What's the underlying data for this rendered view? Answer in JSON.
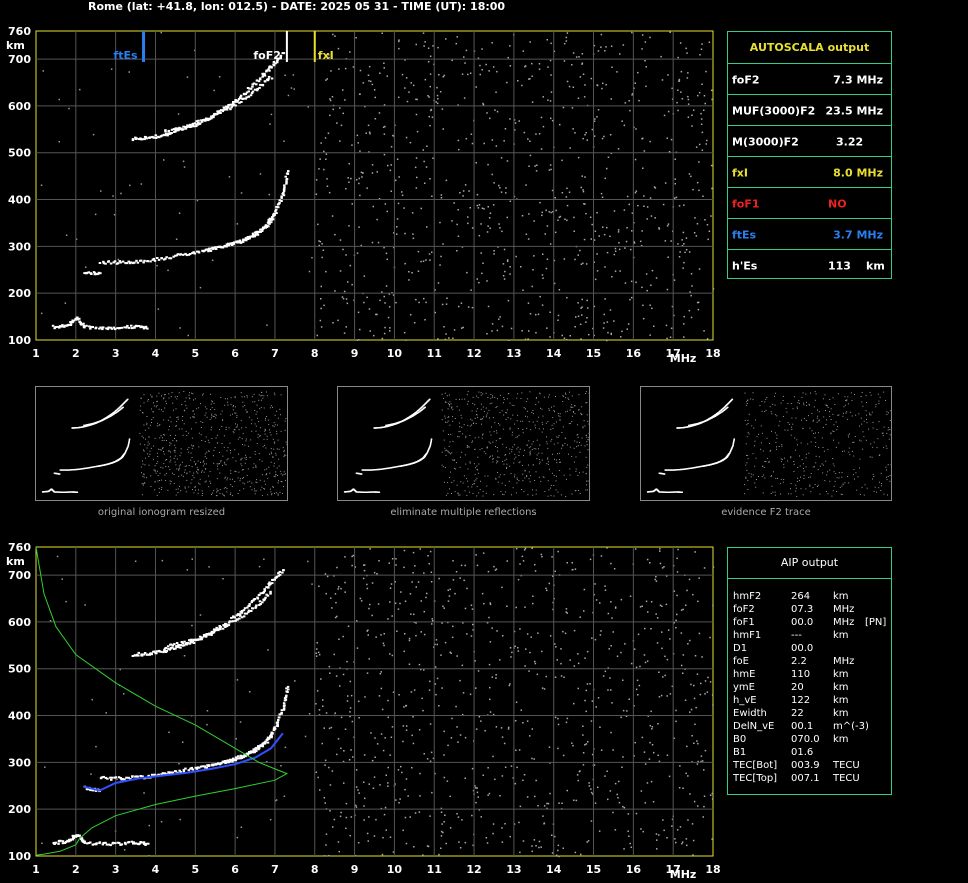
{
  "header": "Rome (lat: +41.8, lon: 012.5) - DATE: 2025 05 31 - TIME (UT): 18:00",
  "axes": {
    "y_unit": "km",
    "x_unit": "MHz",
    "y_ticks": [
      "760",
      "700",
      "600",
      "500",
      "400",
      "300",
      "200",
      "100"
    ],
    "x_ticks": [
      "1",
      "2",
      "3",
      "4",
      "5",
      "6",
      "7",
      "8",
      "9",
      "10",
      "11",
      "12",
      "13",
      "14",
      "15",
      "16",
      "17",
      "18"
    ]
  },
  "markers": {
    "ftEs": {
      "label": "ftEs",
      "freq": 3.7,
      "color": "#2a7ff0"
    },
    "foF2": {
      "label": "foF2",
      "freq": 7.3,
      "color": "#ffffff"
    },
    "fxI": {
      "label": "fxI",
      "freq": 8.0,
      "color": "#e8e030"
    }
  },
  "autoscala": {
    "title": "AUTOSCALA output",
    "rows": [
      {
        "label": "foF2",
        "value": "7.3 MHz",
        "color": "#ffffff"
      },
      {
        "label": "MUF(3000)F2",
        "value": "23.5 MHz",
        "color": "#ffffff"
      },
      {
        "label": "M(3000)F2",
        "value": "3.22",
        "color": "#ffffff"
      },
      {
        "label": "fxI",
        "value": "8.0 MHz",
        "color": "#e8e030"
      },
      {
        "label": "foF1",
        "value": "NO",
        "color": "#ee2020"
      },
      {
        "label": "ftEs",
        "value": "3.7 MHz",
        "color": "#2a7ff0"
      },
      {
        "label": "h'Es",
        "value": "113",
        "unit": "km",
        "color": "#ffffff"
      }
    ]
  },
  "thumbnails": [
    {
      "caption": "original ionogram resized"
    },
    {
      "caption": "eliminate multiple reflections"
    },
    {
      "caption": "evidence F2 trace"
    }
  ],
  "aip": {
    "title": "AIP output",
    "rows": [
      {
        "label": "hmF2",
        "value": "264",
        "unit": "km",
        "extra": ""
      },
      {
        "label": "foF2",
        "value": "07.3",
        "unit": "MHz",
        "extra": ""
      },
      {
        "label": "foF1",
        "value": "00.0",
        "unit": "MHz",
        "extra": "[PN]"
      },
      {
        "label": "hmF1",
        "value": "---",
        "unit": "km",
        "extra": ""
      },
      {
        "label": "D1",
        "value": "00.0",
        "unit": "",
        "extra": ""
      },
      {
        "label": "foE",
        "value": "2.2",
        "unit": "MHz",
        "extra": ""
      },
      {
        "label": "hmE",
        "value": "110",
        "unit": "km",
        "extra": ""
      },
      {
        "label": "ymE",
        "value": "20",
        "unit": "km",
        "extra": ""
      },
      {
        "label": "h_vE",
        "value": "122",
        "unit": "km",
        "extra": ""
      },
      {
        "label": "Ewidth",
        "value": "22",
        "unit": "km",
        "extra": ""
      },
      {
        "label": "DelN_vE",
        "value": "00.1",
        "unit": "m^(-3)",
        "extra": ""
      },
      {
        "label": "B0",
        "value": "070.0",
        "unit": "km",
        "extra": ""
      },
      {
        "label": "B1",
        "value": "01.6",
        "unit": "",
        "extra": ""
      },
      {
        "label": "TEC[Bot]",
        "value": "003.9",
        "unit": "TECU",
        "extra": ""
      },
      {
        "label": "TEC[Top]",
        "value": "007.1",
        "unit": "TECU",
        "extra": ""
      }
    ]
  },
  "chart_data": [
    {
      "type": "scatter",
      "x_range": [
        1,
        18
      ],
      "y_range": [
        100,
        760
      ],
      "grid": true,
      "series": [
        {
          "values": [
            [
              3.4,
              532
            ],
            [
              3.8,
              534
            ],
            [
              4.2,
              540
            ],
            [
              4.6,
              550
            ],
            [
              5.0,
              562
            ],
            [
              5.4,
              580
            ],
            [
              5.8,
              602
            ],
            [
              6.2,
              628
            ],
            [
              6.6,
              660
            ],
            [
              6.9,
              688
            ],
            [
              7.2,
              716
            ]
          ]
        },
        {
          "values": [
            [
              4.2,
              548
            ],
            [
              4.8,
              560
            ],
            [
              5.4,
              578
            ],
            [
              6.0,
              606
            ],
            [
              6.5,
              636
            ],
            [
              6.9,
              666
            ]
          ]
        },
        {
          "values": [
            [
              2.6,
              268
            ],
            [
              3.2,
              268
            ],
            [
              3.8,
              272
            ],
            [
              4.4,
              280
            ],
            [
              5.0,
              290
            ],
            [
              5.6,
              300
            ],
            [
              6.1,
              312
            ],
            [
              6.5,
              328
            ],
            [
              6.8,
              348
            ],
            [
              7.0,
              378
            ],
            [
              7.2,
              420
            ],
            [
              7.3,
              468
            ]
          ]
        },
        {
          "values": [
            [
              5.2,
              292
            ],
            [
              5.8,
              304
            ],
            [
              6.3,
              320
            ],
            [
              6.7,
              342
            ],
            [
              6.95,
              372
            ]
          ]
        },
        {
          "values": [
            [
              2.2,
              248
            ],
            [
              2.6,
              242
            ]
          ]
        },
        {
          "values": [
            [
              1.4,
              130
            ],
            [
              1.8,
              134
            ],
            [
              2.0,
              148
            ],
            [
              2.2,
              130
            ],
            [
              2.8,
              128
            ],
            [
              3.4,
              130
            ],
            [
              3.8,
              128
            ]
          ]
        }
      ]
    },
    {
      "type": "line",
      "x_range": [
        1,
        18
      ],
      "y_range": [
        100,
        760
      ],
      "grid": true,
      "series": [
        {
          "values": [
            [
              2.2,
              248
            ],
            [
              2.6,
              240
            ],
            [
              3.0,
              256
            ],
            [
              3.6,
              266
            ],
            [
              4.2,
              272
            ],
            [
              4.8,
              278
            ],
            [
              5.4,
              286
            ],
            [
              6.0,
              296
            ],
            [
              6.5,
              310
            ],
            [
              6.9,
              330
            ],
            [
              7.2,
              362
            ]
          ]
        },
        {
          "values": [
            [
              1.0,
              760
            ],
            [
              1.2,
              660
            ],
            [
              1.5,
              590
            ],
            [
              2.0,
              530
            ],
            [
              3.0,
              470
            ],
            [
              4.0,
              420
            ],
            [
              5.0,
              380
            ],
            [
              6.0,
              330
            ],
            [
              6.6,
              300
            ],
            [
              7.0,
              286
            ],
            [
              7.3,
              276
            ],
            [
              7.0,
              262
            ],
            [
              6.0,
              244
            ],
            [
              5.0,
              228
            ],
            [
              4.0,
              210
            ],
            [
              3.0,
              186
            ],
            [
              2.4,
              160
            ],
            [
              2.1,
              138
            ],
            [
              2.0,
              124
            ],
            [
              1.6,
              110
            ],
            [
              1.2,
              104
            ],
            [
              1.0,
              102
            ]
          ]
        }
      ]
    }
  ]
}
